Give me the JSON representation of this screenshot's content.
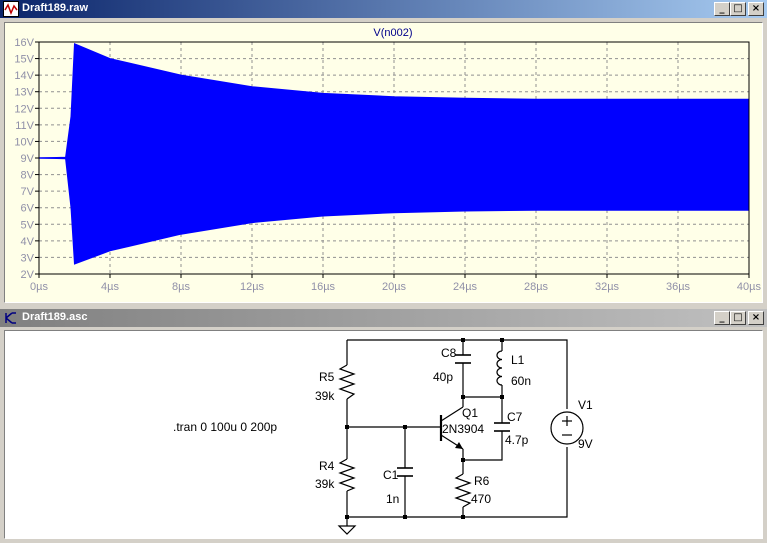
{
  "plot_window": {
    "title": "Draft189.raw",
    "trace_label": "V(n002)",
    "trace_color": "#0000ff",
    "chart_data": {
      "type": "line",
      "title": "",
      "xlabel": "",
      "ylabel": "",
      "series": [
        {
          "name": "V(n002)",
          "upper_envelope": [
            [
              0,
              9.0
            ],
            [
              1.5,
              9.05
            ],
            [
              1.8,
              11.5
            ],
            [
              2.0,
              15.9
            ],
            [
              4,
              15.0
            ],
            [
              8,
              14.0
            ],
            [
              12,
              13.3
            ],
            [
              16,
              12.9
            ],
            [
              20,
              12.7
            ],
            [
              24,
              12.6
            ],
            [
              28,
              12.55
            ],
            [
              32,
              12.55
            ],
            [
              36,
              12.55
            ],
            [
              40,
              12.55
            ]
          ],
          "lower_envelope": [
            [
              0,
              9.0
            ],
            [
              1.5,
              8.95
            ],
            [
              1.8,
              6.0
            ],
            [
              2.0,
              2.6
            ],
            [
              4,
              3.4
            ],
            [
              8,
              4.4
            ],
            [
              12,
              5.1
            ],
            [
              16,
              5.5
            ],
            [
              20,
              5.7
            ],
            [
              24,
              5.8
            ],
            [
              28,
              5.85
            ],
            [
              32,
              5.85
            ],
            [
              36,
              5.85
            ],
            [
              40,
              5.85
            ]
          ]
        }
      ],
      "x_ticks": [
        "0µs",
        "4µs",
        "8µs",
        "12µs",
        "16µs",
        "20µs",
        "24µs",
        "28µs",
        "32µs",
        "36µs",
        "40µs"
      ],
      "y_ticks": [
        "2V",
        "3V",
        "4V",
        "5V",
        "6V",
        "7V",
        "8V",
        "9V",
        "10V",
        "11V",
        "12V",
        "13V",
        "14V",
        "15V",
        "16V"
      ],
      "xlim": [
        0,
        40
      ],
      "ylim": [
        2,
        16
      ],
      "grid": true
    }
  },
  "schematic_window": {
    "title": "Draft189.asc",
    "directive": ".tran 0 100u 0 200p",
    "components": {
      "R5": {
        "name": "R5",
        "value": "39k"
      },
      "R4": {
        "name": "R4",
        "value": "39k"
      },
      "C1": {
        "name": "C1",
        "value": "1n"
      },
      "C8": {
        "name": "C8",
        "value": "40p"
      },
      "L1": {
        "name": "L1",
        "value": "60n"
      },
      "Q1": {
        "name": "Q1",
        "value": "2N3904"
      },
      "C7": {
        "name": "C7",
        "value": "4.7p"
      },
      "R6": {
        "name": "R6",
        "value": "470"
      },
      "V1": {
        "name": "V1",
        "value": "9V"
      }
    }
  },
  "window_buttons": {
    "minimize": "_",
    "maximize": "□",
    "close": "×"
  }
}
